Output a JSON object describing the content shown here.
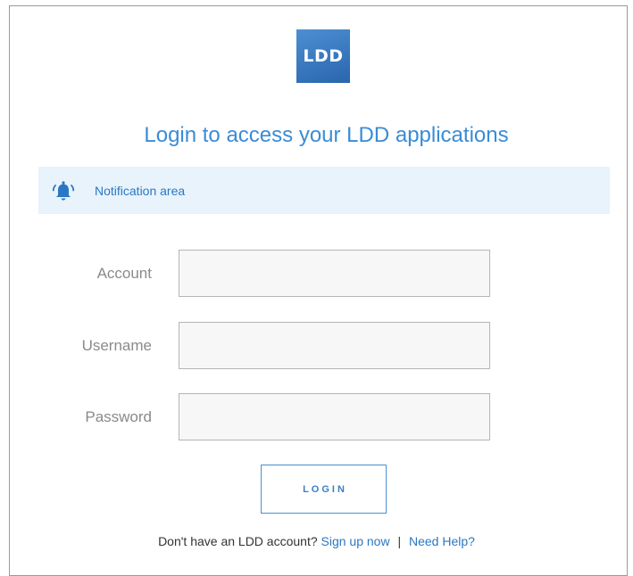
{
  "logo": {
    "text": "LDD"
  },
  "page_title": "Login to access your LDD applications",
  "notification": {
    "icon": "bell-icon",
    "text": "Notification area"
  },
  "form": {
    "account_label": "Account",
    "account_value": "",
    "username_label": "Username",
    "username_value": "",
    "password_label": "Password",
    "password_value": "",
    "login_label": "LOGIN"
  },
  "footer": {
    "prompt": "Don't have an LDD account?",
    "signup_link": "Sign up now",
    "separator": "|",
    "help_link": "Need Help?"
  },
  "colors": {
    "accent": "#3a8cd6",
    "logo_bg": "#3a78c0",
    "notification_bg": "#e8f3fc",
    "link": "#2b77c3"
  }
}
